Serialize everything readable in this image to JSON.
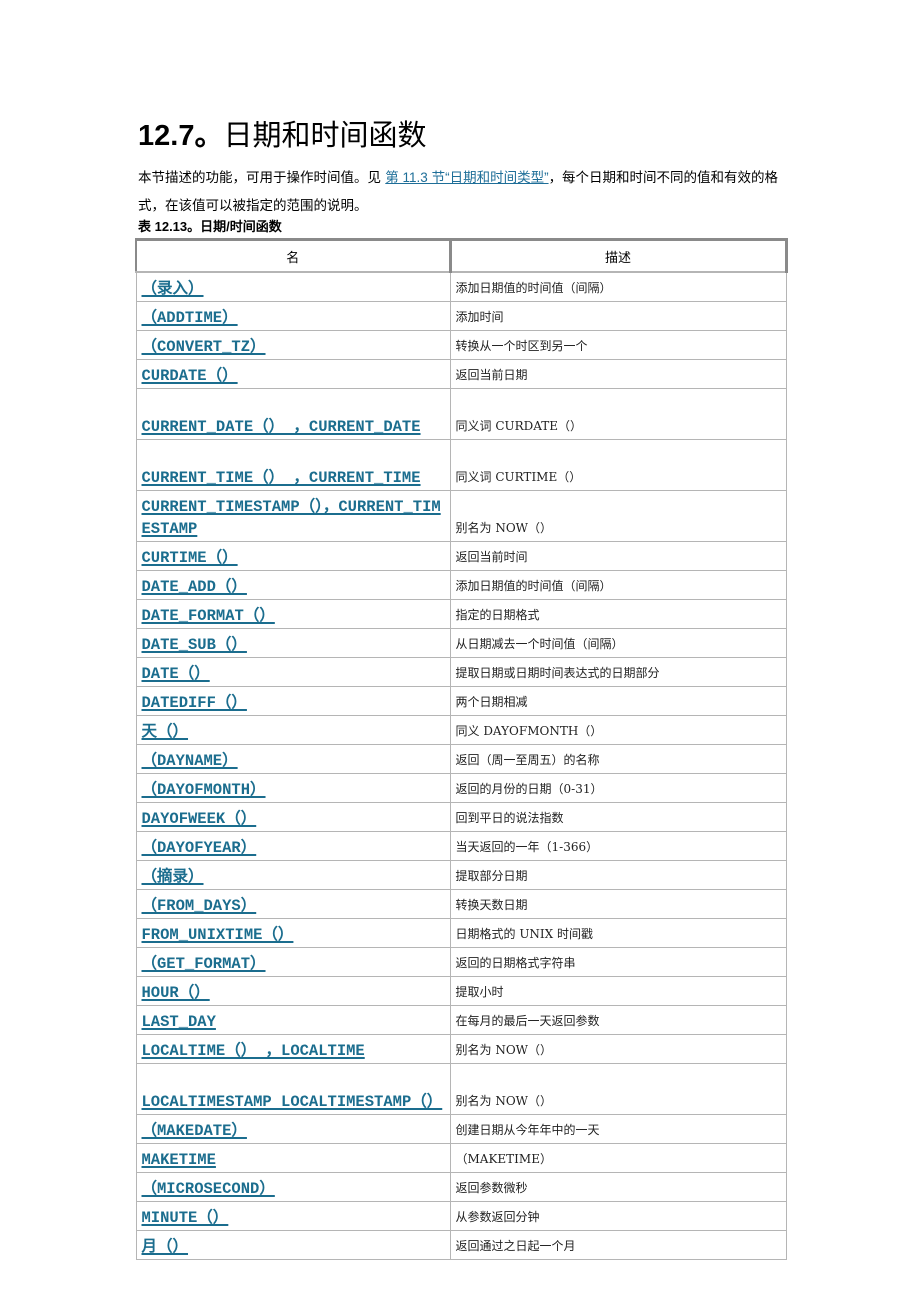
{
  "heading": {
    "number": "12.7。",
    "text": "日期和时间函数"
  },
  "intro": {
    "before": "本节描述的功能，可用于操作时间值。见 ",
    "link": "第 11.3 节“日期和时间类型”",
    "after": "，每个日期和时间不同的值和有效的格式，在该值可以被指定的范围的说明。"
  },
  "table": {
    "caption": "表 12.13。日期/时间函数",
    "headers": [
      "名",
      "描述"
    ],
    "rows": [
      {
        "name": "（录入）",
        "desc": "添加日期值的时间值（间隔）"
      },
      {
        "name": "（ADDTIME）",
        "desc": "添加时间"
      },
      {
        "name": "（CONVERT_TZ）",
        "desc": "转换从一个时区到另一个"
      },
      {
        "name": "CURDATE（）",
        "desc": "返回当前日期"
      },
      {
        "name": "CURRENT_DATE（） ，CURRENT_DATE",
        "desc": "同义词 CURDATE（）"
      },
      {
        "name": "CURRENT_TIME（） ，CURRENT_TIME",
        "desc": "同义词 CURTIME（）"
      },
      {
        "name": "CURRENT_TIMESTAMP（），CURRENT_TIMESTAMP",
        "desc": "别名为 NOW（）"
      },
      {
        "name": "CURTIME（）",
        "desc": "返回当前时间"
      },
      {
        "name": "DATE_ADD（）",
        "desc": "添加日期值的时间值（间隔）"
      },
      {
        "name": "DATE_FORMAT（）",
        "desc": "指定的日期格式"
      },
      {
        "name": "DATE_SUB（）",
        "desc": "从日期减去一个时间值（间隔）"
      },
      {
        "name": "DATE（）",
        "desc": "提取日期或日期时间表达式的日期部分"
      },
      {
        "name": "DATEDIFF（）",
        "desc": "两个日期相减"
      },
      {
        "name": "天（）",
        "desc": "同义 DAYOFMONTH（）"
      },
      {
        "name": "（DAYNAME）",
        "desc": "返回（周一至周五）的名称"
      },
      {
        "name": "（DAYOFMONTH）",
        "desc": "返回的月份的日期（0-31）"
      },
      {
        "name": "DAYOFWEEK（）",
        "desc": "回到平日的说法指数"
      },
      {
        "name": "（DAYOFYEAR）",
        "desc": "当天返回的一年（1-366）"
      },
      {
        "name": "（摘录）",
        "desc": "提取部分日期"
      },
      {
        "name": "（FROM_DAYS）",
        "desc": "转换天数日期"
      },
      {
        "name": "FROM_UNIXTIME（）",
        "desc": "日期格式的 UNIX 时间戳"
      },
      {
        "name": "（GET_FORMAT）",
        "desc": "返回的日期格式字符串"
      },
      {
        "name": "HOUR（）",
        "desc": "提取小时"
      },
      {
        "name": "LAST_DAY",
        "desc": "在每月的最后一天返回参数"
      },
      {
        "name": "LOCALTIME（） ，LOCALTIME",
        "desc": "别名为 NOW（）"
      },
      {
        "name": "LOCALTIMESTAMP LOCALTIMESTAMP（）",
        "desc": "别名为 NOW（）"
      },
      {
        "name": "（MAKEDATE）",
        "desc": "创建日期从今年年中的一天"
      },
      {
        "name": "MAKETIME",
        "desc": "（MAKETIME）"
      },
      {
        "name": "（MICROSECOND）",
        "desc": "返回参数微秒"
      },
      {
        "name": "MINUTE（）",
        "desc": "从参数返回分钟"
      },
      {
        "name": "月（）",
        "desc": "返回通过之日起一个月"
      }
    ]
  }
}
